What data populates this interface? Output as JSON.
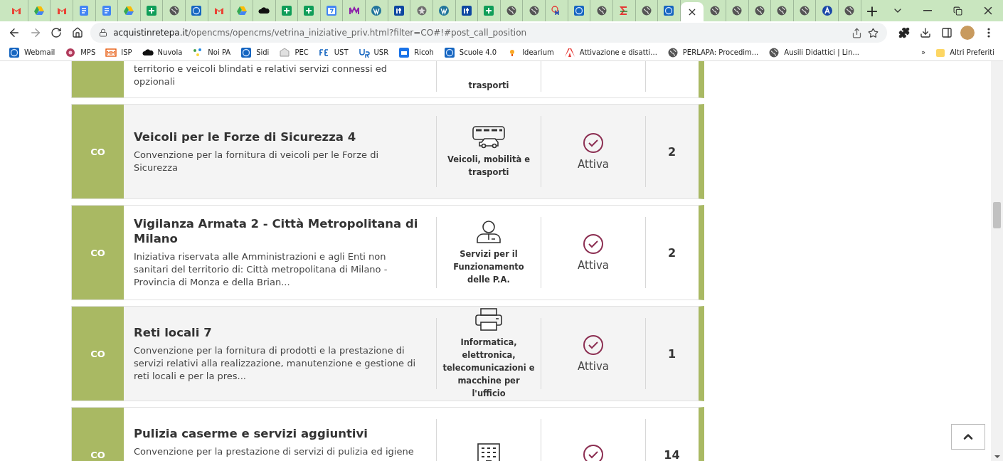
{
  "tabs": [
    {
      "kind": "gmail",
      "selected": false
    },
    {
      "kind": "drive",
      "selected": false
    },
    {
      "kind": "gmail",
      "selected": false
    },
    {
      "kind": "docs",
      "selected": false
    },
    {
      "kind": "docs",
      "selected": false
    },
    {
      "kind": "drive",
      "selected": false
    },
    {
      "kind": "sheets",
      "selected": false
    },
    {
      "kind": "globe",
      "selected": false
    },
    {
      "kind": "gov",
      "selected": false
    },
    {
      "kind": "gmail",
      "selected": false
    },
    {
      "kind": "drive",
      "selected": false
    },
    {
      "kind": "cloud",
      "selected": false
    },
    {
      "kind": "sheets",
      "selected": false
    },
    {
      "kind": "sheets",
      "selected": false
    },
    {
      "kind": "calendar",
      "selected": false
    },
    {
      "kind": "letters",
      "selected": false
    },
    {
      "kind": "wordpress",
      "selected": false
    },
    {
      "kind": "it",
      "selected": false
    },
    {
      "kind": "emblem",
      "selected": false
    },
    {
      "kind": "wordpress",
      "selected": false
    },
    {
      "kind": "it",
      "selected": false
    },
    {
      "kind": "sheets",
      "selected": false
    },
    {
      "kind": "globe",
      "selected": false
    },
    {
      "kind": "globe",
      "selected": false
    },
    {
      "kind": "cm",
      "selected": false
    },
    {
      "kind": "gov",
      "selected": false
    },
    {
      "kind": "globe",
      "selected": false
    },
    {
      "kind": "sigma",
      "selected": false
    },
    {
      "kind": "globe",
      "selected": false
    },
    {
      "kind": "gov",
      "selected": false
    },
    {
      "selected": true,
      "close": "×"
    },
    {
      "kind": "globe",
      "selected": false
    },
    {
      "kind": "globe",
      "selected": false
    },
    {
      "kind": "globe",
      "selected": false
    },
    {
      "kind": "globe",
      "selected": false
    },
    {
      "kind": "globe",
      "selected": false
    },
    {
      "kind": "a",
      "selected": false
    },
    {
      "kind": "globe",
      "selected": false
    }
  ],
  "new_tab": "+",
  "url": {
    "host": "acquistinretepa.it",
    "path": "/opencms/opencms/vetrina_iniziative_priv.html?filter=CO#!#post_call_position"
  },
  "bookmarks": [
    {
      "kind": "gov",
      "label": "Webmail"
    },
    {
      "kind": "mps",
      "label": "MPS"
    },
    {
      "kind": "isp",
      "label": "ISP"
    },
    {
      "kind": "cloud",
      "label": "Nuvola"
    },
    {
      "kind": "noipa",
      "label": "Noi PA"
    },
    {
      "kind": "gov",
      "label": "Sidi"
    },
    {
      "kind": "pec",
      "label": "PEC"
    },
    {
      "kind": "fe",
      "label": "UST"
    },
    {
      "kind": "usr",
      "label": "USR"
    },
    {
      "kind": "ricoh",
      "label": "Ricoh"
    },
    {
      "kind": "gov",
      "label": "Scuole 4.0"
    },
    {
      "kind": "bulb",
      "label": "Idearium"
    },
    {
      "kind": "adobe",
      "label": "Attivazione e disatti..."
    },
    {
      "kind": "globe",
      "label": "PERLAPA: Procedim..."
    },
    {
      "kind": "globe",
      "label": "Ausili Didattici | Lin..."
    }
  ],
  "bookmarks_more": "»",
  "other_bookmarks": "Altri Preferiti",
  "partial_row": {
    "description": "territorio e veicoli blindati e relativi servizi connessi ed opzionali",
    "category": "trasporti"
  },
  "rows": [
    {
      "type": "CO",
      "title": "Veicoli per le Forze di Sicurezza 4",
      "description": "Convenzione per la fornitura di veicoli per le Forze di Sicurezza",
      "kind": "vehicles",
      "category": "Veicoli, mobilità e trasporti",
      "status": "Attiva",
      "count": "2"
    },
    {
      "type": "CO",
      "title": "Vigilanza Armata 2 - Città Metropolitana di Milano",
      "description": "Iniziativa riservata alle Amministrazioni e agli Enti non sanitari del territorio di: Città metropolitana di Milano - Provincia di Monza e della Brian...",
      "kind": "person",
      "category": "Servizi per il Funzionamento delle P.A.",
      "status": "Attiva",
      "count": "2"
    },
    {
      "type": "CO",
      "title": "Reti locali 7",
      "description": "Convenzione per la fornitura di prodotti e la prestazione di servizi relativi alla realizzazione, manutenzione e gestione di reti locali e per la pres...",
      "kind": "printer",
      "category": "Informatica, elettronica, telecomunicazioni e macchine per l'ufficio",
      "status": "Attiva",
      "count": "1"
    },
    {
      "type": "CO",
      "title": "Pulizia caserme e servizi aggiuntivi",
      "description": "Convenzione per la prestazione di servizi di pulizia ed igiene",
      "kind": "building",
      "count": "14"
    }
  ]
}
